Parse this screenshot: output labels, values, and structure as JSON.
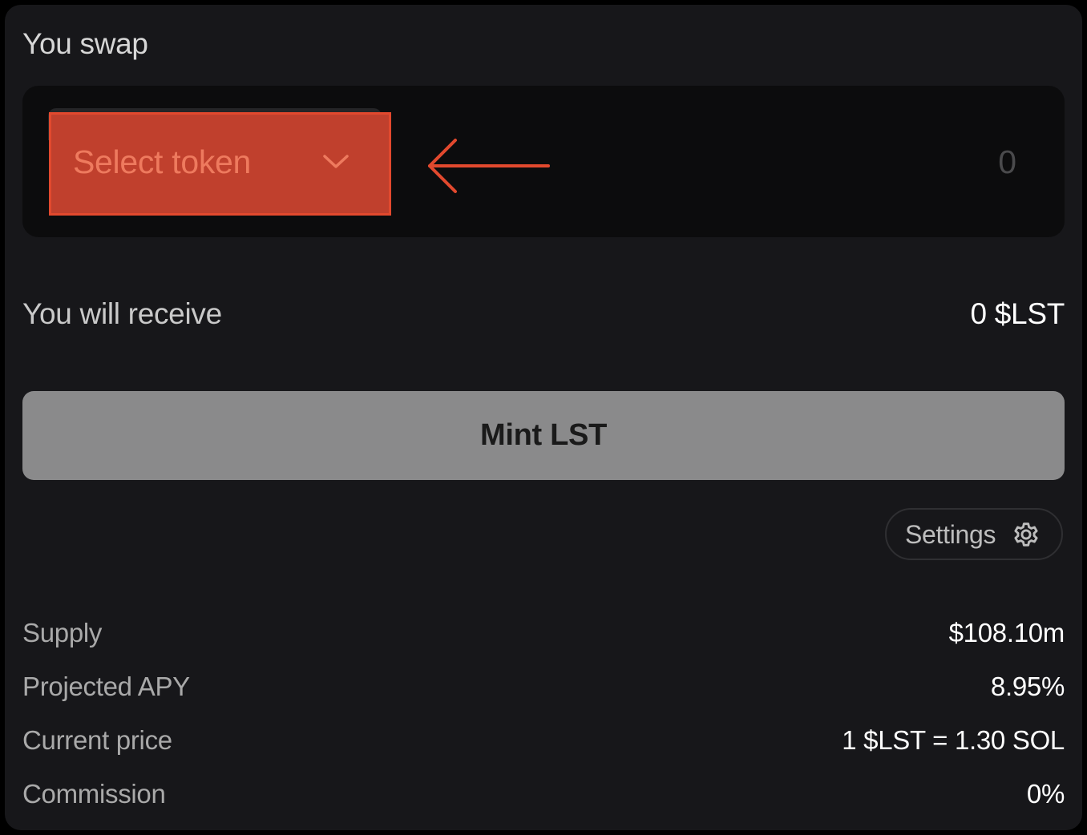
{
  "swap": {
    "title": "You swap",
    "token_select_label": "Select token",
    "amount_placeholder": "0"
  },
  "receive": {
    "label": "You will receive",
    "value": "0 $LST"
  },
  "mint_button_label": "Mint LST",
  "settings": {
    "label": "Settings",
    "icon": "gear-icon"
  },
  "stats": [
    {
      "label": "Supply",
      "value": "$108.10m"
    },
    {
      "label": "Projected APY",
      "value": "8.95%"
    },
    {
      "label": "Current price",
      "value": "1 $LST = 1.30 SOL"
    },
    {
      "label": "Commission",
      "value": "0%"
    }
  ],
  "colors": {
    "panel_background": "#17171a",
    "swap_box_background": "#0c0c0d",
    "highlight": "#e2492e",
    "mint_button": "#8a8a8b"
  },
  "annotation": {
    "highlight_box": "red-rectangle",
    "arrow_icon": "arrow-left-icon"
  }
}
